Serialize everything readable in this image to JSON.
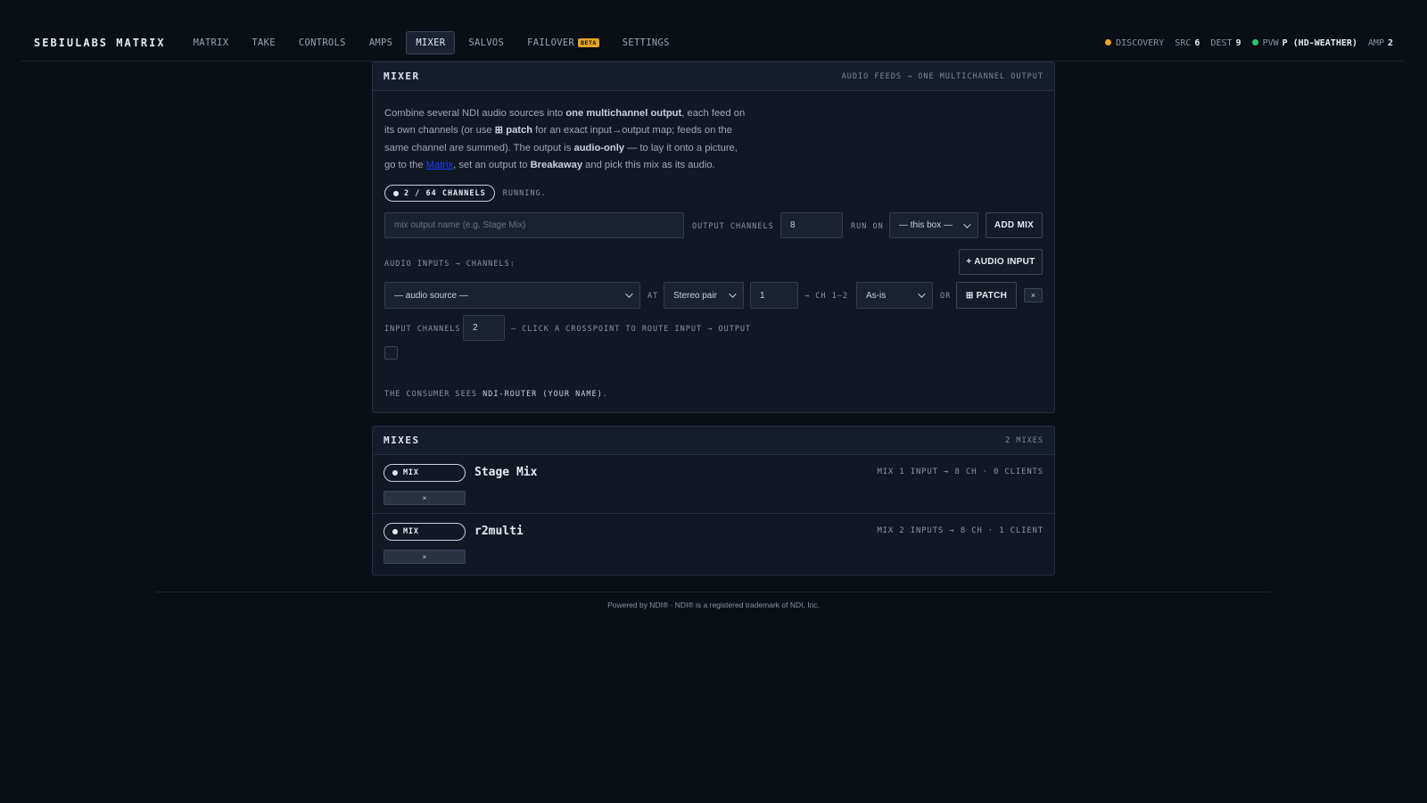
{
  "brand": "SEBIULABS MATRIX",
  "nav": [
    {
      "label": "MATRIX"
    },
    {
      "label": "TAKE"
    },
    {
      "label": "CONTROLS"
    },
    {
      "label": "AMPS"
    },
    {
      "label": "MIXER",
      "active": true
    },
    {
      "label": "SALVOS"
    },
    {
      "label": "FAILOVER",
      "badge": "BETA"
    },
    {
      "label": "SETTINGS"
    }
  ],
  "status": {
    "discovery_label": "DISCOVERY",
    "src_label": "SRC",
    "src_value": "6",
    "dest_label": "DEST",
    "dest_value": "9",
    "pvw_label": "PVW",
    "pvw_value": "P (HD-WEATHER)",
    "amp_label": "AMP",
    "amp_value": "2",
    "discovery_color": "#f0a422",
    "pvw_color": "#28c76f"
  },
  "mixer": {
    "title": "MIXER",
    "subtitle": "AUDIO FEEDS → ONE MULTICHANNEL OUTPUT",
    "desc": {
      "p1": "Combine several NDI audio sources into ",
      "b1": "one multichannel output",
      "p2": ", each feed on its own channels (or use ",
      "b2": "⊞ patch",
      "p3": " for an exact input→output map; feeds on the same channel are summed). The output is ",
      "b3": "audio-only",
      "p4": " — to lay it onto a picture, go to the ",
      "link": "Matrix",
      "p5": ", set an output to ",
      "b4": "Breakaway",
      "p6": " and pick this mix as its audio."
    },
    "channels_pill": "2 / 64 CHANNELS",
    "running": "RUNNING.",
    "name_placeholder": "mix output name (e.g. Stage Mix)",
    "output_channels_label": "OUTPUT CHANNELS",
    "output_channels_value": "8",
    "run_on_label": "RUN ON",
    "run_on_value": "— this box —",
    "add_mix": "ADD MIX",
    "inputs_label": "AUDIO INPUTS → CHANNELS:",
    "add_input": "+ AUDIO INPUT",
    "input_row": {
      "source": "— audio source —",
      "at": "AT",
      "mode": "Stereo pair",
      "start": "1",
      "range": "→ CH 1–2",
      "gain": "As-is",
      "or": "OR",
      "patch": "⊞ PATCH",
      "remove": "×"
    },
    "input_channels_label": "INPUT CHANNELS",
    "input_channels_value": "2",
    "crosspoint_hint": "— CLICK A CROSSPOINT TO ROUTE INPUT → OUTPUT",
    "consumer_prefix": "THE CONSUMER SEES ",
    "consumer_name": "NDI-ROUTER (YOUR NAME)",
    "consumer_suffix": "."
  },
  "mixes": {
    "title": "MIXES",
    "count": "2 MIXES",
    "items": [
      {
        "tag": "MIX",
        "name": "Stage Mix",
        "meta": "MIX 1 INPUT → 8 CH · 0 CLIENTS",
        "remove": "×"
      },
      {
        "tag": "MIX",
        "name": "r2multi",
        "meta": "MIX 2 INPUTS → 8 CH · 1 CLIENT",
        "remove": "×"
      }
    ]
  },
  "footer": "Powered by NDI® · NDI® is a registered trademark of NDI, Inc."
}
